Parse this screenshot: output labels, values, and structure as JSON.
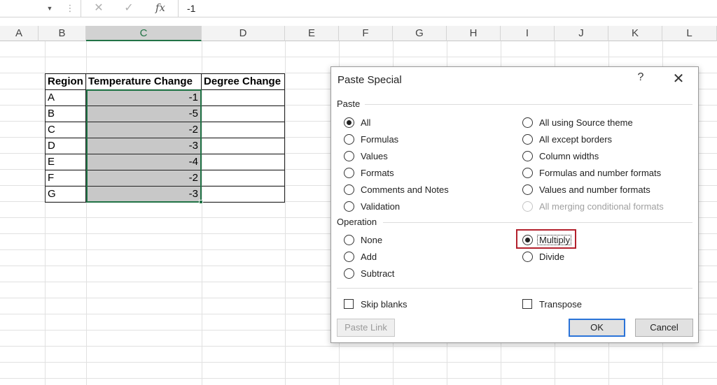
{
  "formula_bar": {
    "dropdown_icon": "chevron-down-icon",
    "cancel_glyph": "✕",
    "enter_glyph": "✓",
    "fx_label": "fx",
    "content": "-1"
  },
  "columns": [
    "A",
    "B",
    "C",
    "D",
    "E",
    "F",
    "G",
    "H",
    "I",
    "J",
    "K",
    "L"
  ],
  "selected_column": "C",
  "table": {
    "headers": [
      "Region",
      "Temperature Change",
      "Degree Change"
    ],
    "rows": [
      {
        "region": "A",
        "temperature_change": "-1",
        "degree_change": ""
      },
      {
        "region": "B",
        "temperature_change": "-5",
        "degree_change": ""
      },
      {
        "region": "C",
        "temperature_change": "-2",
        "degree_change": ""
      },
      {
        "region": "D",
        "temperature_change": "-3",
        "degree_change": ""
      },
      {
        "region": "E",
        "temperature_change": "-4",
        "degree_change": ""
      },
      {
        "region": "F",
        "temperature_change": "-2",
        "degree_change": ""
      },
      {
        "region": "G",
        "temperature_change": "-3",
        "degree_change": ""
      }
    ]
  },
  "dialog": {
    "title": "Paste Special",
    "help": "?",
    "close": "✕",
    "paste_group": {
      "label": "Paste",
      "left_options": [
        {
          "label": "All",
          "selected": true
        },
        {
          "label": "Formulas",
          "selected": false
        },
        {
          "label": "Values",
          "selected": false
        },
        {
          "label": "Formats",
          "selected": false
        },
        {
          "label": "Comments and Notes",
          "selected": false
        },
        {
          "label": "Validation",
          "selected": false
        }
      ],
      "right_options": [
        {
          "label": "All using Source theme",
          "selected": false,
          "disabled": false
        },
        {
          "label": "All except borders",
          "selected": false,
          "disabled": false
        },
        {
          "label": "Column widths",
          "selected": false,
          "disabled": false
        },
        {
          "label": "Formulas and number formats",
          "selected": false,
          "disabled": false
        },
        {
          "label": "Values and number formats",
          "selected": false,
          "disabled": false
        },
        {
          "label": "All merging conditional formats",
          "selected": false,
          "disabled": true
        }
      ]
    },
    "operation_group": {
      "label": "Operation",
      "left_options": [
        {
          "label": "None",
          "selected": false
        },
        {
          "label": "Add",
          "selected": false
        },
        {
          "label": "Subtract",
          "selected": false
        }
      ],
      "right_options": [
        {
          "label": "Multiply",
          "selected": true
        },
        {
          "label": "Divide",
          "selected": false
        }
      ]
    },
    "skip_blanks": {
      "label": "Skip blanks",
      "checked": false
    },
    "transpose": {
      "label": "Transpose",
      "checked": false
    },
    "buttons": {
      "paste_link": "Paste Link",
      "ok": "OK",
      "cancel": "Cancel"
    }
  },
  "colors": {
    "excel_green": "#217346",
    "highlight_red": "#b3202c",
    "selected_fill": "#c8c8c8",
    "ok_border": "#2a73d8"
  }
}
